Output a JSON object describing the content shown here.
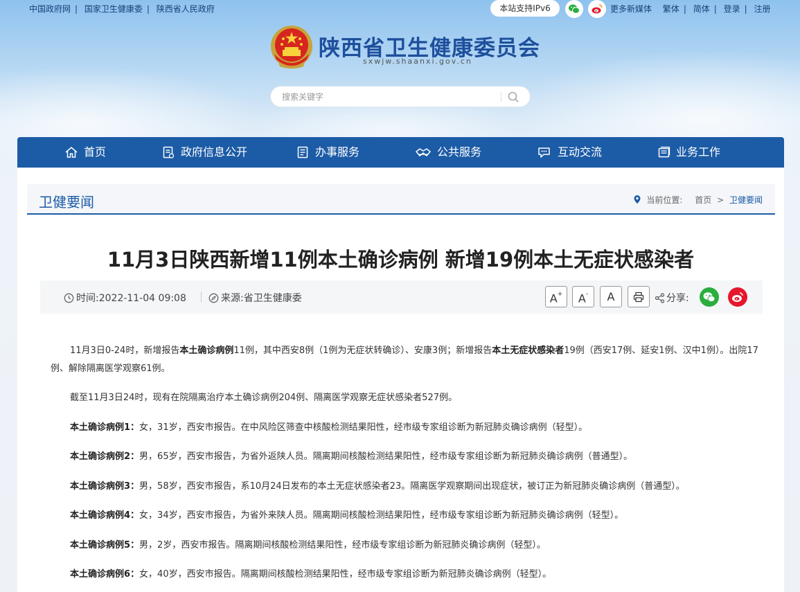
{
  "topbar": {
    "links": [
      "中国政府网",
      "国家卫生健康委",
      "陕西省人民政府"
    ],
    "ipv6": "本站支持IPv6",
    "right": [
      "更多新媒体",
      "繁体",
      "简体",
      "登录",
      "注册"
    ]
  },
  "site": {
    "title": "陕西省卫生健康委员会",
    "domain": "sxwjw.shaanxi.gov.cn"
  },
  "search": {
    "placeholder": "搜索关键字"
  },
  "nav": [
    {
      "label": "首页",
      "icon": "home-icon"
    },
    {
      "label": "政府信息公开",
      "icon": "document-list-icon"
    },
    {
      "label": "办事服务",
      "icon": "form-icon"
    },
    {
      "label": "公共服务",
      "icon": "handshake-icon"
    },
    {
      "label": "互动交流",
      "icon": "chat-icon"
    },
    {
      "label": "业务工作",
      "icon": "briefcase-icon"
    }
  ],
  "section": {
    "title": "卫健要闻"
  },
  "breadcrumb": {
    "prefix": "当前位置:",
    "home": "首页",
    "sep": ">",
    "current": "卫健要闻"
  },
  "article": {
    "title": "11月3日陕西新增11例本土确诊病例 新增19例本土无症状感染者",
    "time_label": "时间:",
    "time": "2022-11-04 09:08",
    "source_label": "来源:",
    "source": "省卫生健康委",
    "font_buttons": [
      "A",
      "A",
      "A"
    ],
    "share_label": "分享:"
  },
  "paragraphs": [
    {
      "parts": [
        {
          "t": "11月3日0-24时，新增报告",
          "b": false
        },
        {
          "t": "本土确诊病例",
          "b": true
        },
        {
          "t": "11例，其中西安8例（1例为无症状转确诊）、安康3例；新增报告",
          "b": false
        },
        {
          "t": "本土无症状感染者",
          "b": true
        },
        {
          "t": "19例（西安17例、延安1例、汉中1例）。出院17例、解除隔离医学观察61例。",
          "b": false
        }
      ]
    },
    {
      "parts": [
        {
          "t": "截至11月3日24时，现有在院隔离治疗本土确诊病例204例、隔离医学观察无症状感染者527例。",
          "b": false
        }
      ]
    },
    {
      "parts": [
        {
          "t": "本土确诊病例1：",
          "b": true
        },
        {
          "t": "女，31岁，西安市报告。在中风险区筛查中核酸检测结果阳性，经市级专家组诊断为新冠肺炎确诊病例（轻型）。",
          "b": false
        }
      ]
    },
    {
      "parts": [
        {
          "t": "本土确诊病例2：",
          "b": true
        },
        {
          "t": "男，65岁，西安市报告，为省外返陕人员。隔离期间核酸检测结果阳性，经市级专家组诊断为新冠肺炎确诊病例（普通型）。",
          "b": false
        }
      ]
    },
    {
      "parts": [
        {
          "t": "本土确诊病例3：",
          "b": true
        },
        {
          "t": "男，58岁，西安市报告，系10月24日发布的本土无症状感染者23。隔离医学观察期间出现症状，被订正为新冠肺炎确诊病例（普通型）。",
          "b": false
        }
      ]
    },
    {
      "parts": [
        {
          "t": "本土确诊病例4：",
          "b": true
        },
        {
          "t": "女，34岁，西安市报告，为省外来陕人员。隔离期间核酸检测结果阳性，经市级专家组诊断为新冠肺炎确诊病例（轻型）。",
          "b": false
        }
      ]
    },
    {
      "parts": [
        {
          "t": "本土确诊病例5：",
          "b": true
        },
        {
          "t": "男，2岁，西安市报告。隔离期间核酸检测结果阳性，经市级专家组诊断为新冠肺炎确诊病例（轻型）。",
          "b": false
        }
      ]
    },
    {
      "parts": [
        {
          "t": "本土确诊病例6：",
          "b": true
        },
        {
          "t": "女，40岁，西安市报告。隔离期间核酸检测结果阳性，经市级专家组诊断为新冠肺炎确诊病例（轻型）。",
          "b": false
        }
      ]
    }
  ],
  "colors": {
    "nav_bg": "#1c5ba6",
    "title_blue": "#1e4f9c",
    "wechat_green": "#2aae3d",
    "weibo_red": "#e6162d"
  }
}
